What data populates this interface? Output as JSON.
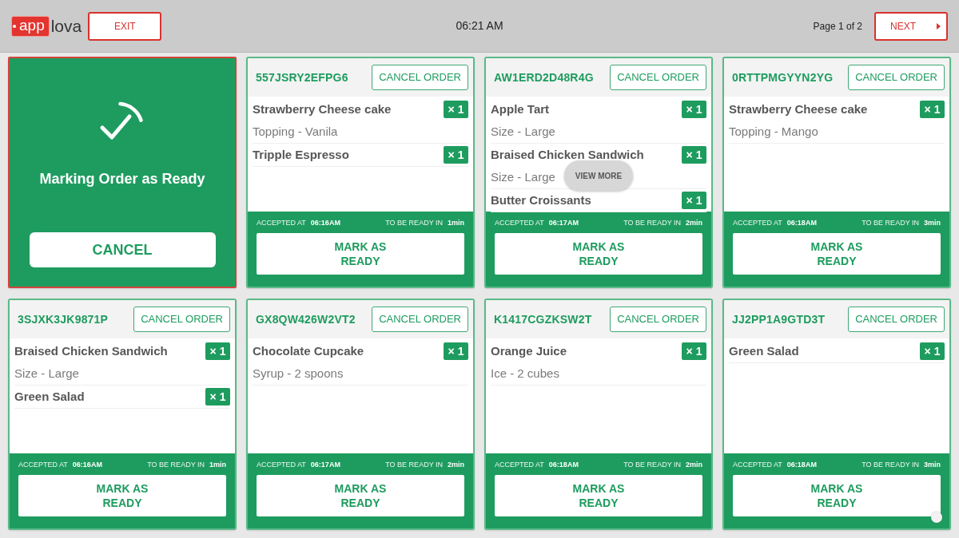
{
  "header": {
    "logo": {
      "badge_text": "app",
      "text": "lova"
    },
    "exit_button": "EXIT",
    "time": "06:21 AM",
    "page_indicator": "Page 1 of 2",
    "next_button": "NEXT"
  },
  "orders": [
    {
      "kind": "marking",
      "message": "Marking Order as Ready",
      "cancel_button": "CANCEL"
    },
    {
      "kind": "order",
      "order_id": "557JSRY2EFPG6",
      "cancel_button": "CANCEL ORDER",
      "items": [
        {
          "name": "Strawberry Cheese cake",
          "quantity": "× 1",
          "modifier": "Topping - Vanila"
        },
        {
          "name": "Tripple Espresso",
          "quantity": "× 1"
        }
      ],
      "accepted_label": "ACCEPTED AT",
      "accepted_time": "06:16AM",
      "ready_label": "TO BE READY IN",
      "ready_in": "1min",
      "mark_button": "MARK AS READY"
    },
    {
      "kind": "order",
      "order_id": "AW1ERD2D48R4G",
      "cancel_button": "CANCEL ORDER",
      "items": [
        {
          "name": "Apple Tart",
          "quantity": "× 1",
          "modifier": "Size - Large"
        },
        {
          "name": "Braised Chicken Sandwich",
          "quantity": "× 1",
          "modifier": "Size - Large"
        },
        {
          "name": "Butter Croissants",
          "quantity": "× 1"
        }
      ],
      "view_more": "VIEW MORE",
      "accepted_label": "ACCEPTED AT",
      "accepted_time": "06:17AM",
      "ready_label": "TO BE READY IN",
      "ready_in": "2min",
      "mark_button": "MARK AS READY"
    },
    {
      "kind": "order",
      "order_id": "0RTTPMGYYN2YG",
      "cancel_button": "CANCEL ORDER",
      "items": [
        {
          "name": "Strawberry Cheese cake",
          "quantity": "× 1",
          "modifier": "Topping - Mango"
        }
      ],
      "accepted_label": "ACCEPTED AT",
      "accepted_time": "06:18AM",
      "ready_label": "TO BE READY IN",
      "ready_in": "3min",
      "mark_button": "MARK AS READY"
    },
    {
      "kind": "order",
      "order_id": "3SJXK3JK9871P",
      "cancel_button": "CANCEL ORDER",
      "items": [
        {
          "name": "Braised Chicken Sandwich",
          "quantity": "× 1",
          "modifier": "Size - Large"
        },
        {
          "name": "Green Salad",
          "quantity": "× 1"
        }
      ],
      "accepted_label": "ACCEPTED AT",
      "accepted_time": "06:16AM",
      "ready_label": "TO BE READY IN",
      "ready_in": "1min",
      "mark_button": "MARK AS READY"
    },
    {
      "kind": "order",
      "order_id": "GX8QW426W2VT2",
      "cancel_button": "CANCEL ORDER",
      "items": [
        {
          "name": "Chocolate Cupcake",
          "quantity": "× 1",
          "modifier": "Syrup - 2 spoons"
        }
      ],
      "accepted_label": "ACCEPTED AT",
      "accepted_time": "06:17AM",
      "ready_label": "TO BE READY IN",
      "ready_in": "2min",
      "mark_button": "MARK AS READY"
    },
    {
      "kind": "order",
      "order_id": "K1417CGZKSW2T",
      "cancel_button": "CANCEL ORDER",
      "items": [
        {
          "name": "Orange Juice",
          "quantity": "× 1",
          "modifier": "Ice - 2 cubes"
        }
      ],
      "accepted_label": "ACCEPTED AT",
      "accepted_time": "06:18AM",
      "ready_label": "TO BE READY IN",
      "ready_in": "2min",
      "mark_button": "MARK AS READY"
    },
    {
      "kind": "order",
      "order_id": "JJ2PP1A9GTD3T",
      "cancel_button": "CANCEL ORDER",
      "items": [
        {
          "name": "Green Salad",
          "quantity": "× 1"
        }
      ],
      "accepted_label": "ACCEPTED AT",
      "accepted_time": "06:18AM",
      "ready_label": "TO BE READY IN",
      "ready_in": "3min",
      "mark_button": "MARK AS READY"
    }
  ]
}
